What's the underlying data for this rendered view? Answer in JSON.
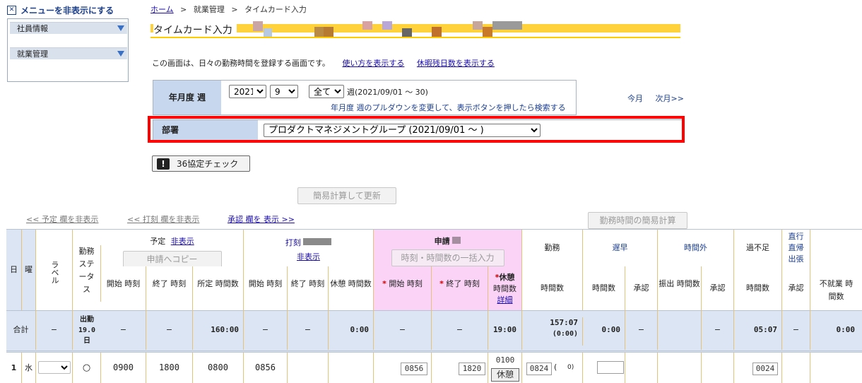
{
  "sidebar": {
    "toggle_label": "メニューを非表示にする",
    "items": [
      {
        "label": "社員情報"
      },
      {
        "label": "就業管理"
      }
    ]
  },
  "breadcrumb": {
    "home": "ホーム",
    "sep": ">",
    "mid": "就業管理",
    "current": "タイムカード入力"
  },
  "page": {
    "title": "タイムカード入力",
    "description": "この画面は、日々の勤務時間を登録する画面です。",
    "link_usage": "使い方を表示する",
    "link_leave": "休暇残日数を表示する"
  },
  "week_form": {
    "label": "年月度 週",
    "year": "2021",
    "month": "9",
    "week": "全て",
    "range": "週(2021/09/01 〜 30)",
    "hint": "年月度 週のプルダウンを変更して、表示ボタンを押したら検索する"
  },
  "nav": {
    "this_month": "今月",
    "next_month": "次月>>"
  },
  "dept": {
    "label": "部署",
    "value": "プロダクトマネジメントグループ (2021/09/01 〜 )"
  },
  "buttons": {
    "check36": "36協定チェック",
    "calc_update": "簡易計算して更新",
    "calc_hours": "勤務時間の簡易計算",
    "copy_request": "申請へコピー",
    "bulk_input": "時刻・時間数の一括入力",
    "rest": "休憩"
  },
  "toggles": {
    "yotei": "<< 予定 欄を非表示",
    "dakoku": "<< 打刻 欄を非表示",
    "shonin": "承認 欄を 表示 >>"
  },
  "table": {
    "head": {
      "day": "日",
      "dow": "曜",
      "label": "ラベル",
      "status": "勤務ステータス",
      "yotei": "予定",
      "yotei_hide": "非表示",
      "dakoku": "打刻",
      "dakoku_hide": "非表示",
      "shinsei": "申請",
      "kinmu": "勤務",
      "chisou": "遅早",
      "jikangai": "時間外",
      "kafusoku": "過不足",
      "chokko": "直行 直帰 出張",
      "start": "開始 時刻",
      "end": "終了 時刻",
      "shotei": "所定 時間数",
      "rest": "休憩 時間数",
      "rest_req": "休憩",
      "rest_req_sub": "時間数",
      "detail": "詳細",
      "hours": "時間数",
      "approve": "承認",
      "furidashi": "振出 時間数",
      "fushugyo": "不就業 時間数",
      "req_mark": "*"
    },
    "total": {
      "label": "合計",
      "dash": "−",
      "status": "出勤 19.0 日",
      "shotei": "160:00",
      "dakoku_rest": "0:00",
      "shinsei_rest": "19:00",
      "kinmu": "157:07",
      "kinmu_sub": "(0:00)",
      "chisou": "0:00",
      "kafusoku": "05:07",
      "fushugyo": "0:00"
    },
    "rows": [
      {
        "day": "1",
        "dow": "水",
        "status": "○",
        "yotei_start": "0900",
        "yotei_end": "1800",
        "shotei": "0800",
        "dakoku_start": "0856",
        "req_start": "0856",
        "req_end": "1820",
        "req_rest": "0100",
        "kinmu": "0824",
        "kinmu_paren": "(",
        "kinmu_tail": "0)",
        "kafusoku": "0024"
      }
    ]
  }
}
